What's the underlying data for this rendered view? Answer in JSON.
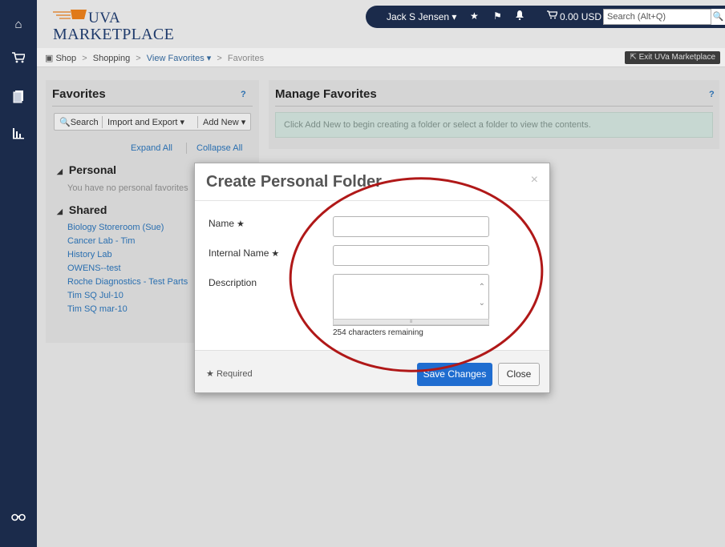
{
  "nav": {
    "icons": [
      "home-icon",
      "cart-icon",
      "documents-icon",
      "reports-icon",
      "binoculars-icon"
    ]
  },
  "header": {
    "logo_line1": "UVA",
    "logo_line2": "MARKETPLACE",
    "user": "Jack S Jensen ▾",
    "cart_total": "0.00 USD",
    "search_placeholder": "Search (Alt+Q)",
    "exit_label": "Exit UVa Marketplace"
  },
  "breadcrumb": {
    "shop": "Shop",
    "shopping": "Shopping",
    "view_favorites": "View Favorites ▾",
    "favorites": "Favorites"
  },
  "favorites": {
    "title": "Favorites",
    "help": "?",
    "search_label": "Search",
    "import_label": "Import and Export ▾",
    "addnew_label": "Add New ▾",
    "expand_all": "Expand All",
    "collapse_all": "Collapse All",
    "personal_label": "Personal",
    "personal_empty": "You have no personal favorites",
    "shared_label": "Shared",
    "shared_items": [
      "Biology Storeroom (Sue)",
      "Cancer Lab - Tim",
      "History Lab",
      "OWENS--test",
      "Roche Diagnostics - Test Parts",
      "Tim SQ Jul-10",
      "Tim SQ mar-10"
    ]
  },
  "manage": {
    "title": "Manage Favorites",
    "help": "?",
    "info": "Click Add New to begin creating a folder or select a folder to view the contents."
  },
  "modal": {
    "title": "Create Personal Folder",
    "close_x": "×",
    "name_label": "Name",
    "internal_name_label": "Internal Name",
    "description_label": "Description",
    "chars_remaining": "254 characters remaining",
    "required_note": "Required",
    "save_label": "Save Changes",
    "close_label": "Close"
  },
  "colors": {
    "nav_bg": "#1b2b4b",
    "primary_button": "#1f6dd0",
    "link": "#2a6fb0",
    "annotation": "#b01818"
  }
}
